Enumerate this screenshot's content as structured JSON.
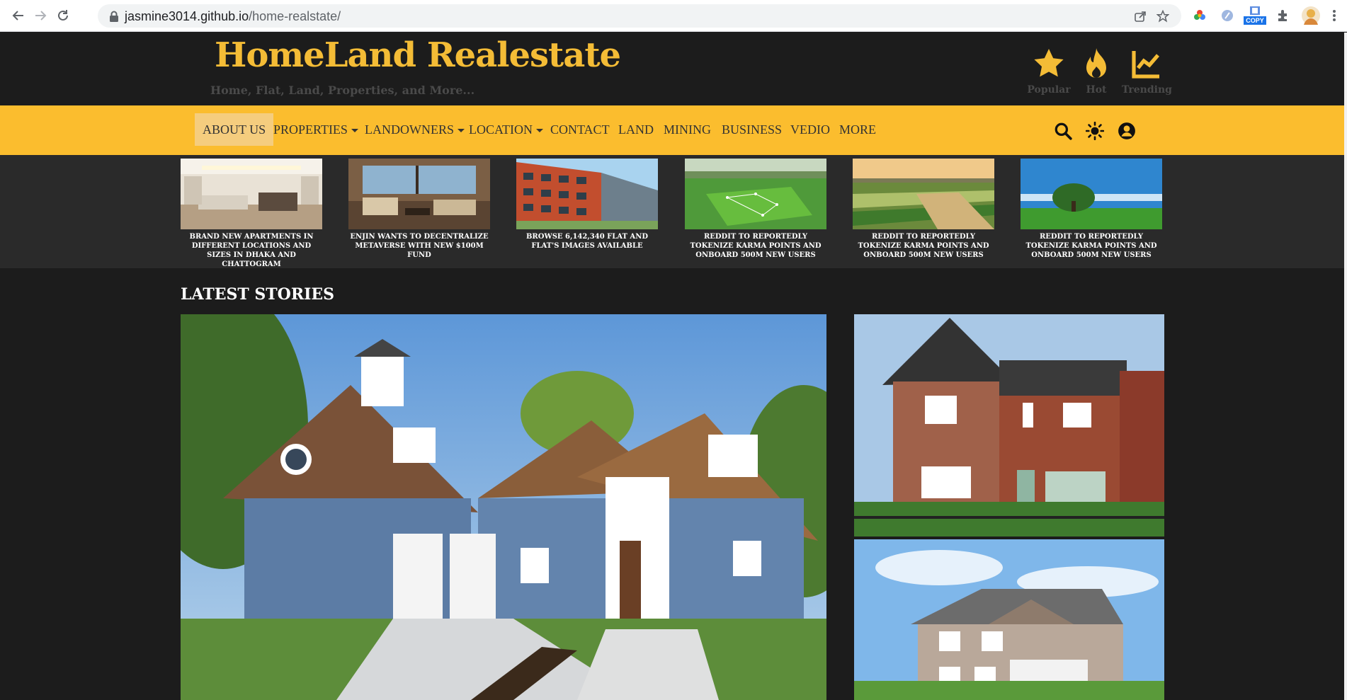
{
  "browser": {
    "url_host": "jasmine3014.github.io",
    "url_path": "/home-realstate/",
    "copy_badge": "COPY"
  },
  "site": {
    "brand": "HomeLand Realestate",
    "tagline": "Home, Flat, Land, Properties, and More...",
    "header_links": [
      {
        "label": "Popular",
        "icon": "star-icon"
      },
      {
        "label": "Hot",
        "icon": "flame-icon"
      },
      {
        "label": "Trending",
        "icon": "trending-chart-icon"
      }
    ],
    "nav": [
      {
        "label": "ABOUT US",
        "dropdown": false,
        "active": true
      },
      {
        "label": "PROPERTIES",
        "dropdown": true
      },
      {
        "label": "LANDOWNERS",
        "dropdown": true
      },
      {
        "label": "LOCATION",
        "dropdown": true
      },
      {
        "label": "CONTACT",
        "dropdown": false
      },
      {
        "label": "LAND",
        "dropdown": false
      },
      {
        "label": "MINING",
        "dropdown": false
      },
      {
        "label": "BUSINESS",
        "dropdown": false
      },
      {
        "label": "VEDIO",
        "dropdown": false
      },
      {
        "label": "MORE",
        "dropdown": false
      }
    ],
    "nav_icons": [
      "search-icon",
      "brightness-icon",
      "user-circle-icon"
    ],
    "cards": [
      {
        "caption": "BRAND NEW APARTMENTS IN DIFFERENT LOCATIONS AND SIZES IN DHAKA AND CHATTOGRAM"
      },
      {
        "caption": "ENJIN WANTS TO DECENTRALIZE METAVERSE WITH NEW $100M FUND"
      },
      {
        "caption": "BROWSE 6,142,340 FLAT AND FLAT'S IMAGES AVAILABLE"
      },
      {
        "caption": "REDDIT TO REPORTEDLY TOKENIZE KARMA POINTS AND ONBOARD 500M NEW USERS"
      },
      {
        "caption": "REDDIT TO REPORTEDLY TOKENIZE KARMA POINTS AND ONBOARD 500M NEW USERS"
      },
      {
        "caption": "REDDIT TO REPORTEDLY TOKENIZE KARMA POINTS AND ONBOARD 500M NEW USERS"
      }
    ],
    "latest_title": "LATEST STORIES"
  },
  "colors": {
    "brand": "#f4bc36",
    "navbar": "#fbbd2e",
    "background": "#1c1c1c",
    "strip": "#2a2a2a"
  }
}
